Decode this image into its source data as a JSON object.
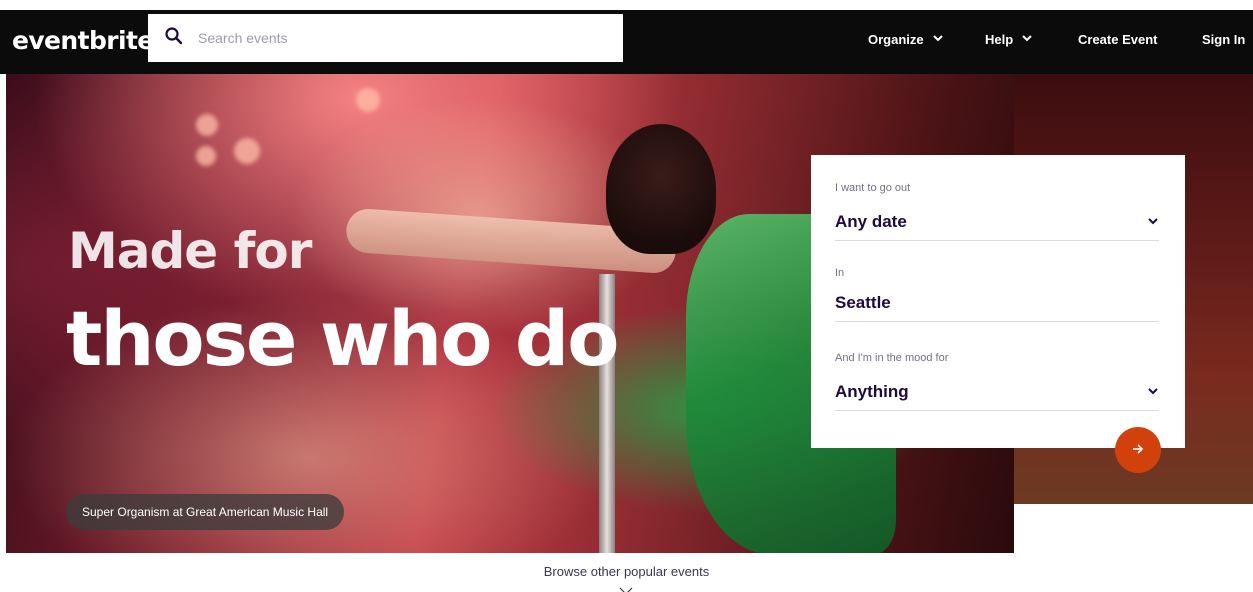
{
  "header": {
    "logo": "eventbrite",
    "search_placeholder": "Search events",
    "nav": {
      "organize": "Organize",
      "help": "Help",
      "create_event": "Create Event",
      "sign_in": "Sign In"
    }
  },
  "hero": {
    "headline_line1": "Made for",
    "headline_line2": "those who do",
    "caption": "Super Organism at Great American Music Hall"
  },
  "filter_card": {
    "date_label": "I want to go out",
    "date_value": "Any date",
    "location_label": "In",
    "location_value": "Seattle",
    "mood_label": "And I'm in the mood for",
    "mood_value": "Anything"
  },
  "browse_link": "Browse other popular events",
  "colors": {
    "header_bg": "#0b0b0b",
    "accent": "#d1410c",
    "card_text": "#1e0a3c"
  },
  "icons": [
    "search-icon",
    "chevron-down-icon",
    "arrow-right-icon"
  ]
}
